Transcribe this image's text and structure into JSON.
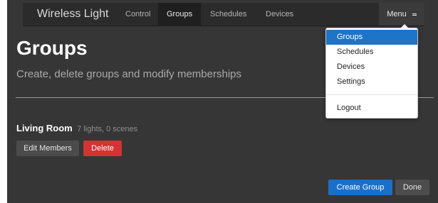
{
  "navbar": {
    "brand": "Wireless Light",
    "links": [
      "Control",
      "Groups",
      "Schedules",
      "Devices"
    ],
    "active_link": "Groups",
    "menu_label": "Menu"
  },
  "page": {
    "title": "Groups",
    "subtitle": "Create, delete groups and modify memberships"
  },
  "groups": [
    {
      "name": "Living Room",
      "meta": "7 lights, 0 scenes",
      "edit_label": "Edit Members",
      "delete_label": "Delete"
    }
  ],
  "footer": {
    "create_label": "Create Group",
    "done_label": "Done"
  },
  "menu_dropdown": {
    "items": [
      "Groups",
      "Schedules",
      "Devices",
      "Settings"
    ],
    "highlighted": "Groups",
    "logout_label": "Logout"
  },
  "colors": {
    "background": "#363636",
    "navbar": "#2b2b2b",
    "primary": "#1a6fc9",
    "danger": "#d23333",
    "dropdown_highlight": "#1e74c6"
  }
}
